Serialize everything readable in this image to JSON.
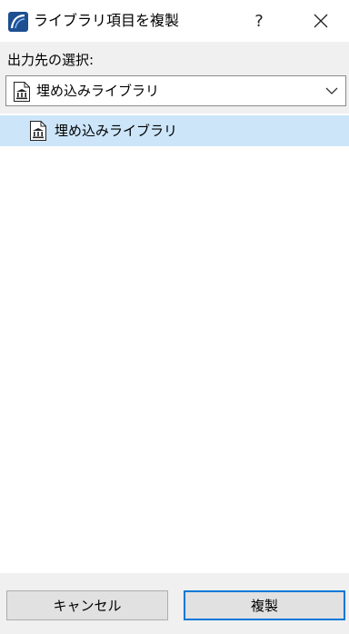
{
  "window": {
    "title": "ライブラリ項目を複製",
    "help_label": "?"
  },
  "destination": {
    "label": "出力先の選択:",
    "selected_value": "埋め込みライブラリ"
  },
  "library_list": {
    "items": [
      {
        "label": "埋め込みライブラリ",
        "selected": true
      }
    ]
  },
  "buttons": {
    "cancel_label": "キャンセル",
    "duplicate_label": "複製"
  },
  "icons": {
    "app": "archicad-app-icon",
    "library": "embedded-library-icon",
    "dropdown": "chevron-down-icon",
    "close": "close-icon"
  },
  "colors": {
    "accent": "#0078d7",
    "selection": "#cce5f9",
    "panel": "#f0f0f0"
  }
}
